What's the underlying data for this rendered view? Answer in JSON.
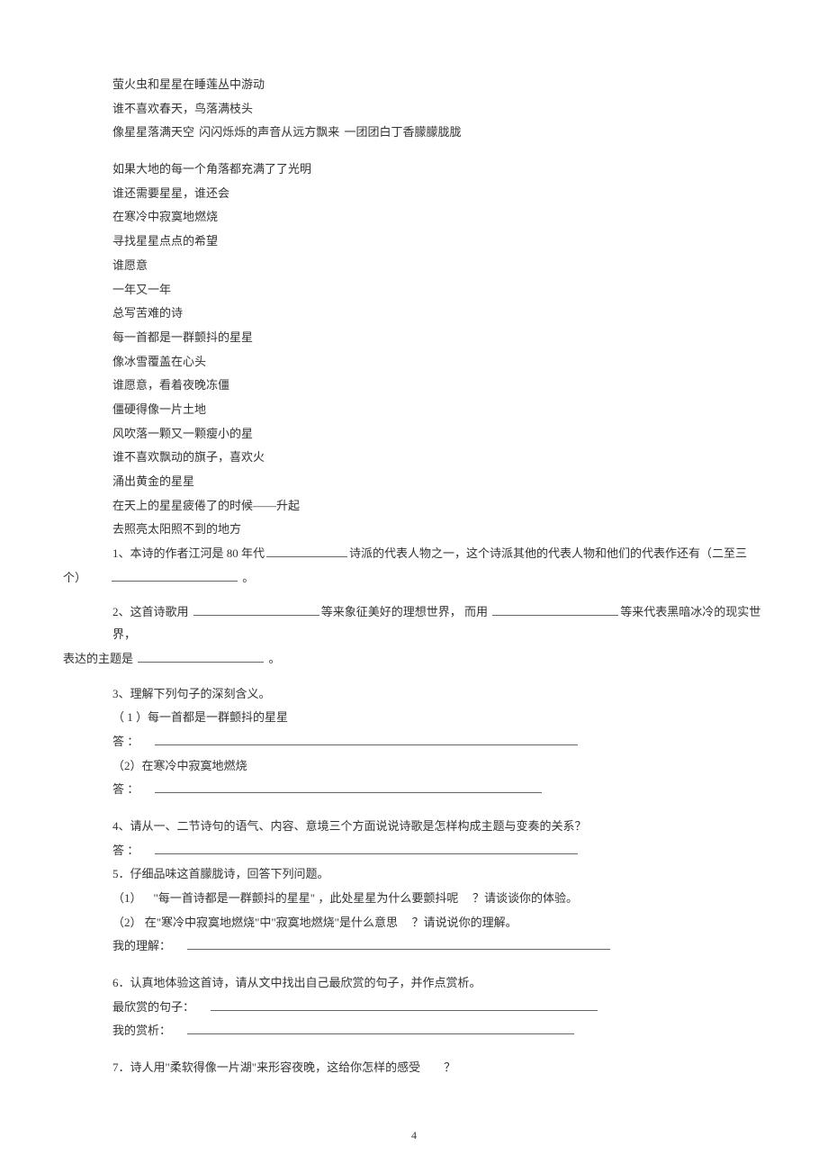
{
  "poem": {
    "stanza1": [
      "萤火虫和星星在睡莲丛中游动",
      "谁不喜欢春天，鸟落满枝头",
      "像星星落满天空 闪闪烁烁的声音从远方飘来 一团团白丁香朦朦胧胧"
    ],
    "stanza2": [
      "如果大地的每一个角落都充满了了光明",
      "谁还需要星星，谁还会",
      "在寒冷中寂寞地燃烧",
      "寻找星星点点的希望",
      "谁愿意",
      "一年又一年",
      "总写苦难的诗",
      "每一首都是一群颤抖的星星",
      "像冰雪覆盖在心头",
      "谁愿意，看着夜晚冻僵",
      "僵硬得像一片土地",
      "风吹落一颗又一颗瘦小的星",
      "谁不喜欢飘动的旗子，喜欢火",
      "涌出黄金的星星",
      "在天上的星星疲倦了的时候——升起",
      "去照亮太阳照不到的地方"
    ]
  },
  "questions": {
    "q1": {
      "text_before": "1、本诗的作者江河是 80 年代",
      "text_mid": "诗派的代表人物之一，这个诗派其他的代表人物和他们的代表作还有（二至三",
      "cont": "个）",
      "period": "。"
    },
    "q2": {
      "text_before": "2、这首诗歌用",
      "text_mid1": "等来象征美好的理想世界， 而用",
      "text_mid2": "等来代表黑暗冰冷的现实世界，",
      "cont": "表达的主题是",
      "period": "。"
    },
    "q3": {
      "title": "3、理解下列句子的深刻含义。",
      "p1": "（ 1 ）每一首都是一群颤抖的星星",
      "ans": "答 ：",
      "p2": "（2）在寒冷中寂寞地燃烧"
    },
    "q4": {
      "title": "4、请从一、二节诗句的语气、内容、意境三个方面说说诗歌是怎样构成主题与变奏的关系？",
      "ans": "答 ："
    },
    "q5": {
      "title": "5．仔细品味这首朦胧诗，回答下列问题。",
      "p1a": "（1） \"每一首诗都是一群颤抖的星星\" ，此处星星为什么要颤抖呢",
      "p1b": "？请谈谈你的体验。",
      "p2a": "（2） 在\"寒冷中寂寞地燃烧\"中\"寂寞地燃烧\"是什么意思",
      "p2b": "？请说说你的理解。",
      "ans": "我的理解：",
      "ansb": ""
    },
    "q6": {
      "title": "6．认真地体验这首诗，请从文中找出自己最欣赏的句子，并作点赏析。",
      "p1": "最欣赏的句子：",
      "p2": "我的赏析：",
      "blank": ""
    },
    "q7": {
      "text_a": "7．诗人用\"柔软得像一片湖\"来形容夜晚，这给你怎样的感受",
      "text_b": "？"
    }
  },
  "footer": {
    "page_num": "4"
  }
}
